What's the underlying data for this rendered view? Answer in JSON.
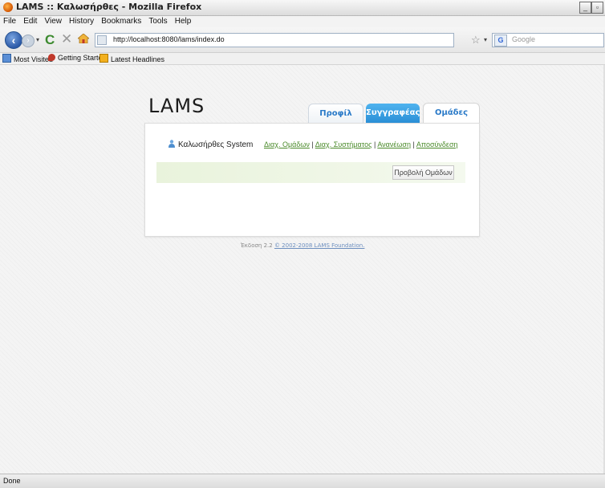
{
  "window": {
    "title": "LAMS :: Καλωσήρθες - Mozilla Firefox",
    "minimize": "_",
    "restore": "▫"
  },
  "menubar": [
    "File",
    "Edit",
    "View",
    "History",
    "Bookmarks",
    "Tools",
    "Help"
  ],
  "navbar": {
    "back": "‹",
    "forward": "›",
    "reload": "C",
    "stop": "✕",
    "url": "http://localhost:8080/lams/index.do",
    "search_placeholder": "Google",
    "search_engine": "G"
  },
  "bookmarks": [
    "Most Visited",
    "Getting Started",
    "Latest Headlines"
  ],
  "page": {
    "logo": "LAMS",
    "tabs": [
      "Προφίλ",
      "Συγγραφέας",
      "Ομάδες"
    ],
    "user_greeting": "Καλωσήρθες System",
    "links": [
      "Διαχ. Ομάδων",
      "Διαχ. Συστήματος",
      "Ανανέωση",
      "Αποσύνδεση"
    ],
    "link_separator": "|",
    "view_groups_button": "Προβολή Ομάδων",
    "footer_version": "Έκδοση 2.2",
    "footer_copyright": "© 2002-2008 LAMS Foundation."
  },
  "status": "Done",
  "colors": {
    "tab_active": "#2a8fd6",
    "link_green": "#4a8a2a",
    "panel_bar": "#e9f3dc"
  }
}
